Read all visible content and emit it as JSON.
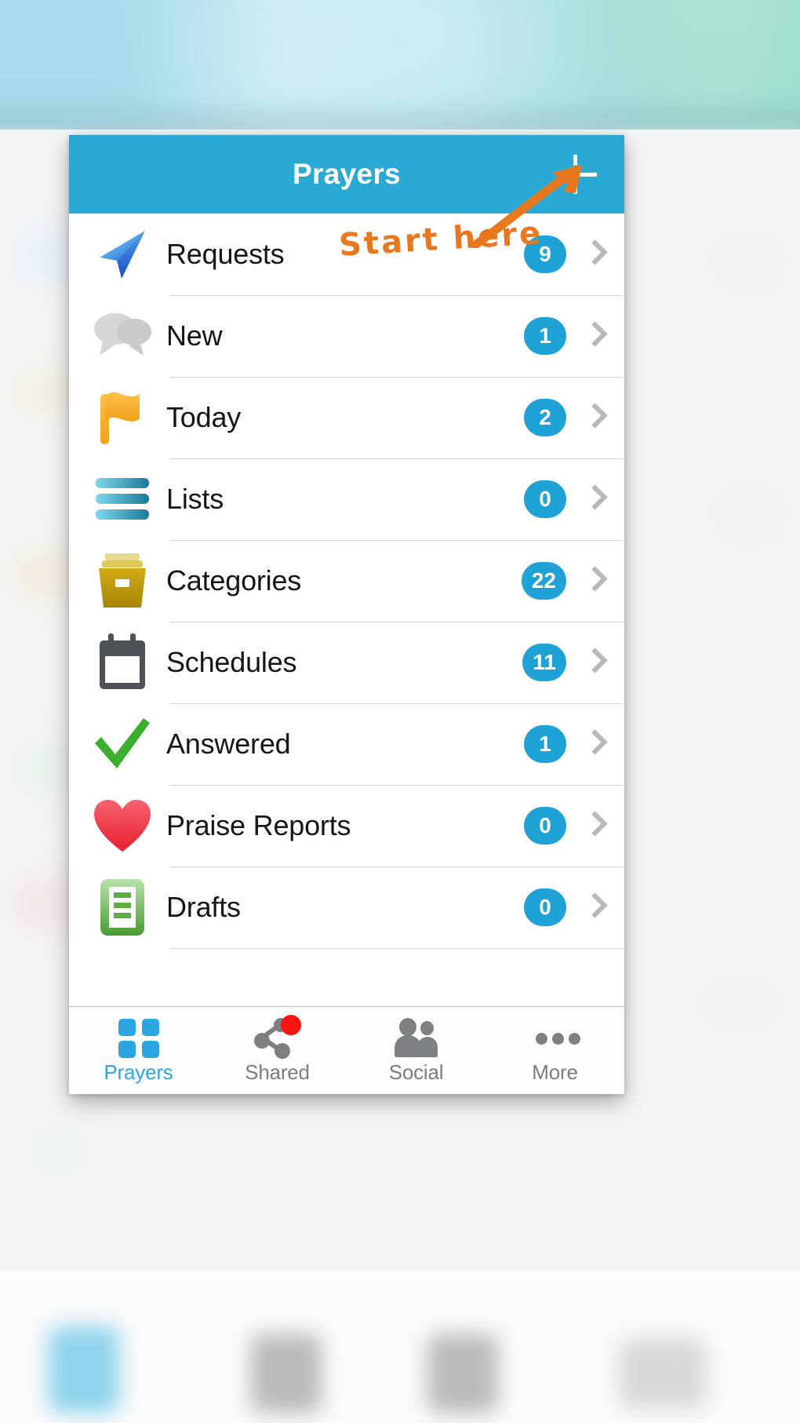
{
  "header": {
    "title": "Prayers",
    "add_icon": "plus-icon"
  },
  "annotation": {
    "text": "Start here",
    "color": "#e8781e",
    "arrow_icon": "arrow-up-right-icon"
  },
  "colors": {
    "nav_background": "#29a9d4",
    "badge_background": "#1fa2d6",
    "accent": "#2ba6e0",
    "annotation_orange": "#e8781e",
    "backdrop_blue": "#7ecbe4"
  },
  "list": {
    "items": [
      {
        "label": "Requests",
        "badge": "9",
        "icon": "paper-plane-icon"
      },
      {
        "label": "New",
        "badge": "1",
        "icon": "speech-bubbles-icon"
      },
      {
        "label": "Today",
        "badge": "2",
        "icon": "flag-icon"
      },
      {
        "label": "Lists",
        "badge": "0",
        "icon": "list-bars-icon"
      },
      {
        "label": "Categories",
        "badge": "22",
        "icon": "file-box-icon"
      },
      {
        "label": "Schedules",
        "badge": "11",
        "icon": "calendar-icon"
      },
      {
        "label": "Answered",
        "badge": "1",
        "icon": "check-mark-icon"
      },
      {
        "label": "Praise Reports",
        "badge": "0",
        "icon": "heart-icon"
      },
      {
        "label": "Drafts",
        "badge": "0",
        "icon": "notepad-icon"
      }
    ],
    "chevron_icon": "chevron-right-icon"
  },
  "tabbar": {
    "tabs": [
      {
        "label": "Prayers",
        "icon": "grid-icon",
        "active": true,
        "badge": ""
      },
      {
        "label": "Shared",
        "icon": "share-icon",
        "active": false,
        "badge": "dot"
      },
      {
        "label": "Social",
        "icon": "people-icon",
        "active": false,
        "badge": ""
      },
      {
        "label": "More",
        "icon": "ellipsis-icon",
        "active": false,
        "badge": ""
      }
    ]
  }
}
